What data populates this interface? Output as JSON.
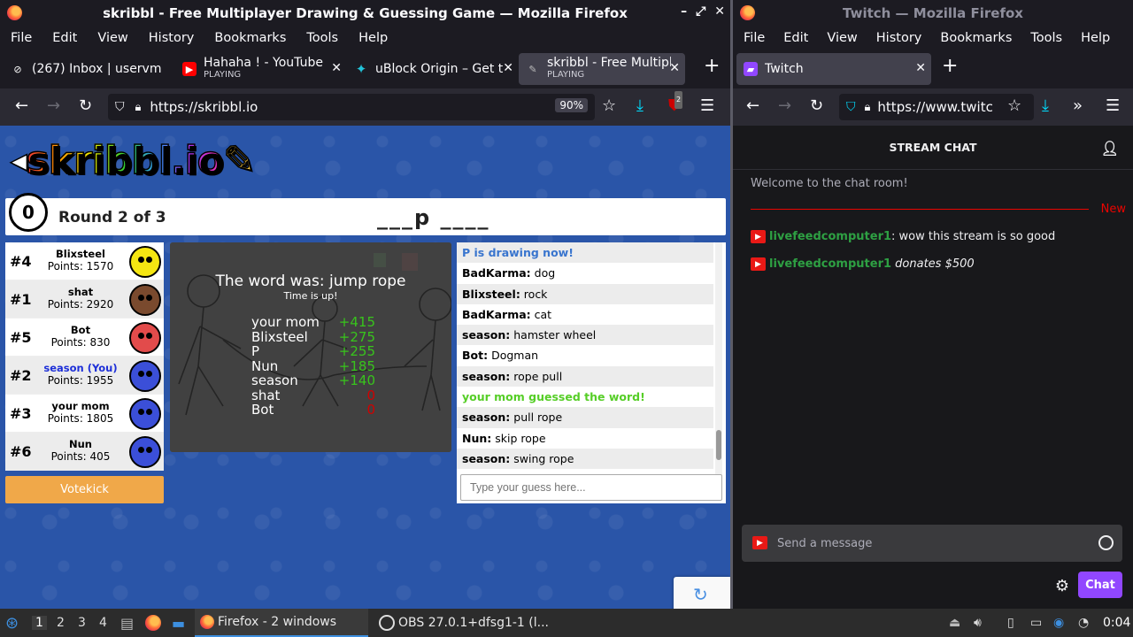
{
  "left_window": {
    "title": "skribbl - Free Multiplayer Drawing & Guessing Game — Mozilla Firefox",
    "menu": [
      "File",
      "Edit",
      "View",
      "History",
      "Bookmarks",
      "Tools",
      "Help"
    ],
    "tabs": [
      {
        "title": "(267) Inbox | uservm",
        "sub": "",
        "icon": "mail-icon"
      },
      {
        "title": "Hahaha ! - YouTube",
        "sub": "PLAYING",
        "icon": "youtube-icon"
      },
      {
        "title": "uBlock Origin – Get t",
        "sub": "",
        "icon": "puzzle-icon"
      },
      {
        "title": "skribbl - Free Multipl",
        "sub": "PLAYING",
        "icon": "skribbl-icon"
      }
    ],
    "url": "https://skribbl.io",
    "zoom": "90%",
    "extension_badge": "2"
  },
  "skribbl": {
    "logo": "skribbl.io",
    "timer": "0",
    "round": "Round 2 of 3",
    "word_hint": "___p ____",
    "players": [
      {
        "rank": "#4",
        "name": "Blixsteel",
        "points": "Points: 1570",
        "color": "#f5e612",
        "you": false
      },
      {
        "rank": "#1",
        "name": "shat",
        "points": "Points: 2920",
        "color": "#7a4a2e",
        "you": false
      },
      {
        "rank": "#5",
        "name": "Bot",
        "points": "Points: 830",
        "color": "#e24b4b",
        "you": false
      },
      {
        "rank": "#2",
        "name": "season (You)",
        "points": "Points: 1955",
        "color": "#3b4fd8",
        "you": true
      },
      {
        "rank": "#3",
        "name": "your mom",
        "points": "Points: 1805",
        "color": "#3b4fd8",
        "you": false
      },
      {
        "rank": "#6",
        "name": "Nun",
        "points": "Points: 405",
        "color": "#3b4fd8",
        "you": false
      }
    ],
    "votekick": "Votekick",
    "word_was": "The word was: jump rope",
    "time_up": "Time is up!",
    "round_scores": [
      {
        "name": "your mom",
        "delta": "+415"
      },
      {
        "name": "Blixsteel",
        "delta": "+275"
      },
      {
        "name": "P",
        "delta": "+255"
      },
      {
        "name": "Nun",
        "delta": "+185"
      },
      {
        "name": "season",
        "delta": "+140"
      },
      {
        "name": "shat",
        "delta": "0"
      },
      {
        "name": "Bot",
        "delta": "0"
      }
    ],
    "chat": [
      {
        "type": "draw",
        "text": "P is drawing now!"
      },
      {
        "type": "msg",
        "user": "BadKarma:",
        "text": " dog"
      },
      {
        "type": "msg",
        "user": "Blixsteel:",
        "text": " rock"
      },
      {
        "type": "msg",
        "user": "BadKarma:",
        "text": " cat"
      },
      {
        "type": "msg",
        "user": "season:",
        "text": " hamster wheel"
      },
      {
        "type": "msg",
        "user": "Bot:",
        "text": " Dogman"
      },
      {
        "type": "msg",
        "user": "season:",
        "text": " rope pull"
      },
      {
        "type": "ok",
        "text": "your mom guessed the word!"
      },
      {
        "type": "msg",
        "user": "season:",
        "text": " pull rope"
      },
      {
        "type": "msg",
        "user": "Nun:",
        "text": " skip rope"
      },
      {
        "type": "msg",
        "user": "season:",
        "text": " swing rope"
      }
    ],
    "guess_placeholder": "Type your guess here..."
  },
  "right_window": {
    "title": "Twitch — Mozilla Firefox",
    "menu": [
      "File",
      "Edit",
      "View",
      "History",
      "Bookmarks",
      "Tools",
      "Help"
    ],
    "tab": "Twitch",
    "url": "https://www.twitc"
  },
  "twitch": {
    "header": "STREAM CHAT",
    "welcome": "Welcome to the chat room!",
    "new_label": "New",
    "messages": [
      {
        "user": "livefeedcomputer1",
        "sep": ":",
        "text": " wow this stream is so good",
        "italic": false
      },
      {
        "user": "livefeedcomputer1",
        "sep": "",
        "text": " donates $500",
        "italic": true
      }
    ],
    "send_placeholder": "Send a message",
    "chat_button": "Chat"
  },
  "taskbar": {
    "workspaces": [
      "1",
      "2",
      "3",
      "4"
    ],
    "firefox_item": "Firefox - 2 windows",
    "obs_item": "OBS 27.0.1+dfsg1-1 (l...",
    "clock": "0:04"
  }
}
